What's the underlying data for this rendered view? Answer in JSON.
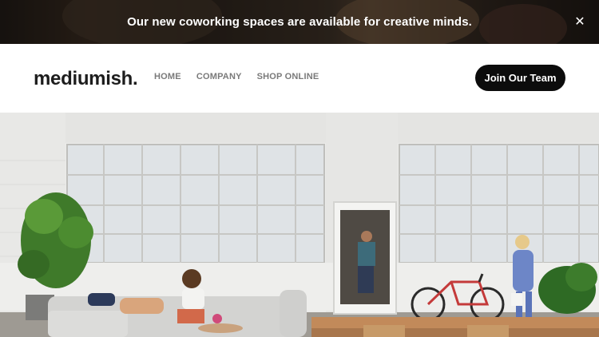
{
  "announcement": {
    "message": "Our new coworking spaces are available for creative minds.",
    "close_icon": "close-icon"
  },
  "header": {
    "logo": "mediumish.",
    "nav": [
      {
        "label": "HOME"
      },
      {
        "label": "COMPANY"
      },
      {
        "label": "SHOP ONLINE"
      }
    ],
    "cta_label": "Join Our Team"
  },
  "hero": {
    "image": "office-photo"
  },
  "colors": {
    "announcement_bg": "#2b221c",
    "cta_bg": "#0c0c0c",
    "nav_text": "#7a7a7a",
    "logo_text": "#1d1d1d"
  }
}
